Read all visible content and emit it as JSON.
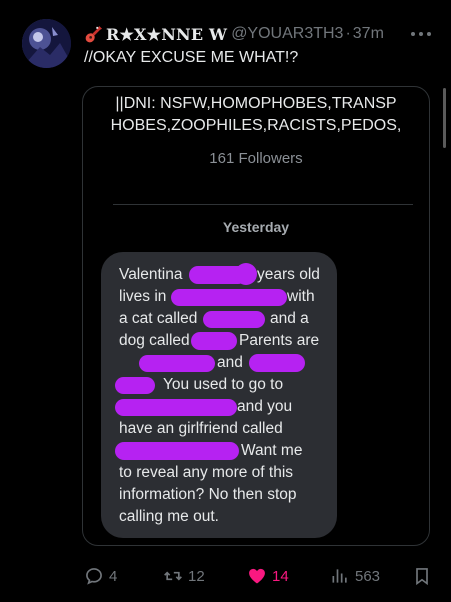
{
  "tweet": {
    "display_name": "R★X★NNE W",
    "handle": "@YOUAR3TH3",
    "separator": "·",
    "time": "37m",
    "text": "//OKAY EXCUSE ME WHAT!?"
  },
  "quote": {
    "bio_line1": "||DNI: NSFW,HOMOPHOBES,TRANSP",
    "bio_line2": "HOBES,ZOOPHILES,RACISTS,PEDOS,",
    "followers": "161 Followers",
    "day_label": "Yesterday",
    "message": {
      "valentina": "Valentina",
      "years_old": "years old",
      "lives_in": "lives in",
      "with": "with",
      "cat_called": "a cat called",
      "and_a": "and a",
      "dog_called": "dog called",
      "parents_are": "Parents are",
      "and": "and",
      "used_to_go": "You used to go to",
      "and_you": "and you",
      "have_girlfriend": "have an girlfriend called",
      "want_me": "Want me",
      "line10": "to reveal any more of this",
      "line11": "information? No then stop",
      "line12": "calling me out."
    },
    "redaction_color": "#b622f2"
  },
  "actions": {
    "replies": "4",
    "reposts": "12",
    "likes": "14",
    "views": "563",
    "like_color": "#f91880"
  }
}
